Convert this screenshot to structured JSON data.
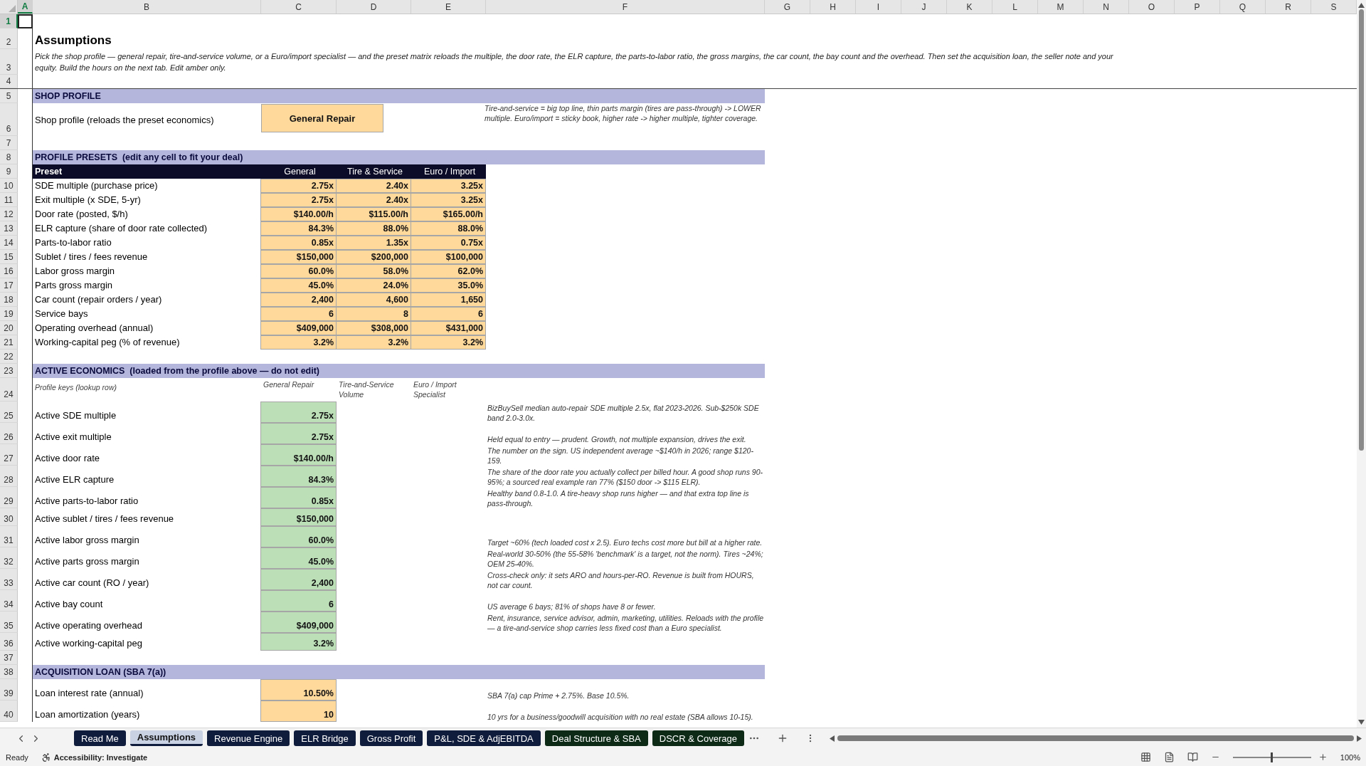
{
  "columns": [
    {
      "label": "A",
      "selected": true
    },
    {
      "label": "B",
      "selected": false
    },
    {
      "label": "C",
      "selected": false
    },
    {
      "label": "D",
      "selected": false
    },
    {
      "label": "E",
      "selected": false
    },
    {
      "label": "F",
      "selected": false
    },
    {
      "label": "G",
      "selected": false
    },
    {
      "label": "H",
      "selected": false
    },
    {
      "label": "I",
      "selected": false
    },
    {
      "label": "J",
      "selected": false
    },
    {
      "label": "K",
      "selected": false
    },
    {
      "label": "L",
      "selected": false
    },
    {
      "label": "M",
      "selected": false
    },
    {
      "label": "N",
      "selected": false
    },
    {
      "label": "O",
      "selected": false
    },
    {
      "label": "P",
      "selected": false
    },
    {
      "label": "Q",
      "selected": false
    },
    {
      "label": "R",
      "selected": false
    },
    {
      "label": "S",
      "selected": false
    }
  ],
  "rows": [
    {
      "number": "1",
      "kind": "blank",
      "selected": true
    },
    {
      "number": "2",
      "kind": "title",
      "selected": false,
      "text": "Assumptions"
    },
    {
      "number": "3",
      "kind": "intro",
      "selected": false,
      "text": "Pick the shop profile — general repair, tire-and-service volume, or a Euro/import specialist — and the preset matrix reloads the multiple, the door rate, the ELR capture, the parts-to-labor ratio, the gross margins, the car count, the bay count and the overhead. Then set the acquisition loan, the seller note and your equity. Build the hours on the next tab. Edit amber only."
    },
    {
      "number": "4",
      "kind": "divider",
      "selected": false
    },
    {
      "number": "5",
      "kind": "section",
      "selected": false,
      "text": "SHOP PROFILE"
    },
    {
      "number": "6",
      "kind": "profile",
      "selected": false,
      "label": "Shop profile (reloads the preset economics)",
      "value": "General Repair",
      "note": "Tire-and-service = big top line, thin parts margin (tires are pass-through) -> LOWER multiple. Euro/import = sticky book, higher rate -> higher multiple, tighter coverage."
    },
    {
      "number": "7",
      "kind": "blank",
      "selected": false
    },
    {
      "number": "8",
      "kind": "section",
      "selected": false,
      "text": "PROFILE PRESETS  (edit any cell to fit your deal)"
    },
    {
      "number": "9",
      "kind": "preset_header",
      "selected": false,
      "cells": [
        "Preset",
        "General",
        "Tire & Service",
        "Euro / Import"
      ]
    },
    {
      "number": "10",
      "kind": "preset",
      "selected": false,
      "label": "SDE multiple (purchase price)",
      "values": [
        "2.75x",
        "2.40x",
        "3.25x"
      ]
    },
    {
      "number": "11",
      "kind": "preset",
      "selected": false,
      "label": "Exit multiple (x SDE, 5-yr)",
      "values": [
        "2.75x",
        "2.40x",
        "3.25x"
      ]
    },
    {
      "number": "12",
      "kind": "preset",
      "selected": false,
      "label": "Door rate (posted, $/h)",
      "values": [
        "$140.00/h",
        "$115.00/h",
        "$165.00/h"
      ]
    },
    {
      "number": "13",
      "kind": "preset",
      "selected": false,
      "label": "ELR capture (share of door rate collected)",
      "values": [
        "84.3%",
        "88.0%",
        "88.0%"
      ]
    },
    {
      "number": "14",
      "kind": "preset",
      "selected": false,
      "label": "Parts-to-labor ratio",
      "values": [
        "0.85x",
        "1.35x",
        "0.75x"
      ]
    },
    {
      "number": "15",
      "kind": "preset",
      "selected": false,
      "label": "Sublet / tires / fees revenue",
      "values": [
        "$150,000",
        "$200,000",
        "$100,000"
      ]
    },
    {
      "number": "16",
      "kind": "preset",
      "selected": false,
      "label": "Labor gross margin",
      "values": [
        "60.0%",
        "58.0%",
        "62.0%"
      ]
    },
    {
      "number": "17",
      "kind": "preset",
      "selected": false,
      "label": "Parts gross margin",
      "values": [
        "45.0%",
        "24.0%",
        "35.0%"
      ]
    },
    {
      "number": "18",
      "kind": "preset",
      "selected": false,
      "label": "Car count (repair orders / year)",
      "values": [
        "2,400",
        "4,600",
        "1,650"
      ]
    },
    {
      "number": "19",
      "kind": "preset",
      "selected": false,
      "label": "Service bays",
      "values": [
        "6",
        "8",
        "6"
      ]
    },
    {
      "number": "20",
      "kind": "preset",
      "selected": false,
      "label": "Operating overhead (annual)",
      "values": [
        "$409,000",
        "$308,000",
        "$431,000"
      ]
    },
    {
      "number": "21",
      "kind": "preset",
      "selected": false,
      "label": "Working-capital peg (% of revenue)",
      "values": [
        "3.2%",
        "3.2%",
        "3.2%"
      ]
    },
    {
      "number": "22",
      "kind": "blank",
      "selected": false
    },
    {
      "number": "23",
      "kind": "section",
      "selected": false,
      "text": "ACTIVE ECONOMICS  (loaded from the profile above — do not edit)"
    },
    {
      "number": "24",
      "kind": "keys",
      "selected": false,
      "label": "Profile keys (lookup row)",
      "keys": [
        "General Repair",
        "Tire-and-Service Volume",
        "Euro / Import Specialist"
      ]
    },
    {
      "number": "25",
      "kind": "active",
      "selected": false,
      "label": "Active SDE multiple",
      "value": "2.75x",
      "note": "BizBuySell median auto-repair SDE multiple 2.5x, flat 2023-2026. Sub-$250k SDE band 2.0-3.0x."
    },
    {
      "number": "26",
      "kind": "active",
      "selected": false,
      "label": "Active exit multiple",
      "value": "2.75x",
      "note": "Held equal to entry — prudent. Growth, not multiple expansion, drives the exit."
    },
    {
      "number": "27",
      "kind": "active",
      "selected": false,
      "label": "Active door rate",
      "value": "$140.00/h",
      "note": "The number on the sign. US independent average ~$140/h in 2026; range $120-159."
    },
    {
      "number": "28",
      "kind": "active",
      "selected": false,
      "label": "Active ELR capture",
      "value": "84.3%",
      "note": "The share of the door rate you actually collect per billed hour. A good shop runs 90-95%; a sourced real example ran 77% ($150 door -> $115 ELR)."
    },
    {
      "number": "29",
      "kind": "active",
      "selected": false,
      "label": "Active parts-to-labor ratio",
      "value": "0.85x",
      "note": "Healthy band 0.8-1.0. A tire-heavy shop runs higher — and that extra top line is pass-through."
    },
    {
      "number": "30",
      "kind": "active",
      "selected": false,
      "label": "Active sublet / tires / fees revenue",
      "value": "$150,000"
    },
    {
      "number": "31",
      "kind": "active",
      "selected": false,
      "label": "Active labor gross margin",
      "value": "60.0%",
      "note": "Target ~60% (tech loaded cost x 2.5). Euro techs cost more but bill at a higher rate."
    },
    {
      "number": "32",
      "kind": "active",
      "selected": false,
      "label": "Active parts gross margin",
      "value": "45.0%",
      "note": "Real-world 30-50% (the 55-58% 'benchmark' is a target, not the norm). Tires ~24%; OEM 25-40%."
    },
    {
      "number": "33",
      "kind": "active",
      "selected": false,
      "label": "Active car count (RO / year)",
      "value": "2,400",
      "note": "Cross-check only: it sets ARO and hours-per-RO. Revenue is built from HOURS, not car count."
    },
    {
      "number": "34",
      "kind": "active",
      "selected": false,
      "label": "Active bay count",
      "value": "6",
      "note": "US average 6 bays; 81% of shops have 8 or fewer."
    },
    {
      "number": "35",
      "kind": "active",
      "selected": false,
      "label": "Active operating overhead",
      "value": "$409,000",
      "note": "Rent, insurance, service advisor, admin, marketing, utilities. Reloads with the profile — a tire-and-service shop carries less fixed cost than a Euro specialist."
    },
    {
      "number": "36",
      "kind": "active",
      "selected": false,
      "label": "Active working-capital peg",
      "value": "3.2%"
    },
    {
      "number": "37",
      "kind": "blank",
      "selected": false
    },
    {
      "number": "38",
      "kind": "section",
      "selected": false,
      "text": "ACQUISITION LOAN (SBA 7(a))"
    },
    {
      "number": "39",
      "kind": "loan",
      "selected": false,
      "label": "Loan interest rate (annual)",
      "value": "10.50%",
      "note": "SBA 7(a) cap Prime + 2.75%. Base 10.5%."
    },
    {
      "number": "40",
      "kind": "loan",
      "selected": false,
      "label": "Loan amortization (years)",
      "value": "10",
      "note": "10 yrs for a business/goodwill acquisition with no real estate (SBA allows 10-15)."
    }
  ],
  "tabs": [
    {
      "label": "Read Me",
      "selected": false,
      "color": "#101c3c"
    },
    {
      "label": "Assumptions",
      "selected": true,
      "color": "#101c3c"
    },
    {
      "label": "Revenue Engine",
      "selected": false,
      "color": "#101c3c"
    },
    {
      "label": "ELR Bridge",
      "selected": false,
      "color": "#101c3c"
    },
    {
      "label": "Gross Profit",
      "selected": false,
      "color": "#101c3c"
    },
    {
      "label": "P&L, SDE & AdjEBITDA",
      "selected": false,
      "color": "#101c3c"
    },
    {
      "label": "Deal Structure & SBA",
      "selected": false,
      "color": "#0c2a16"
    },
    {
      "label": "DSCR & Coverage",
      "selected": false,
      "color": "#0c2a16"
    }
  ],
  "status_bar": {
    "status": "Ready",
    "accessibility": "Accessibility: Investigate",
    "zoom": {
      "reading": "100%",
      "level": 0.5
    }
  }
}
